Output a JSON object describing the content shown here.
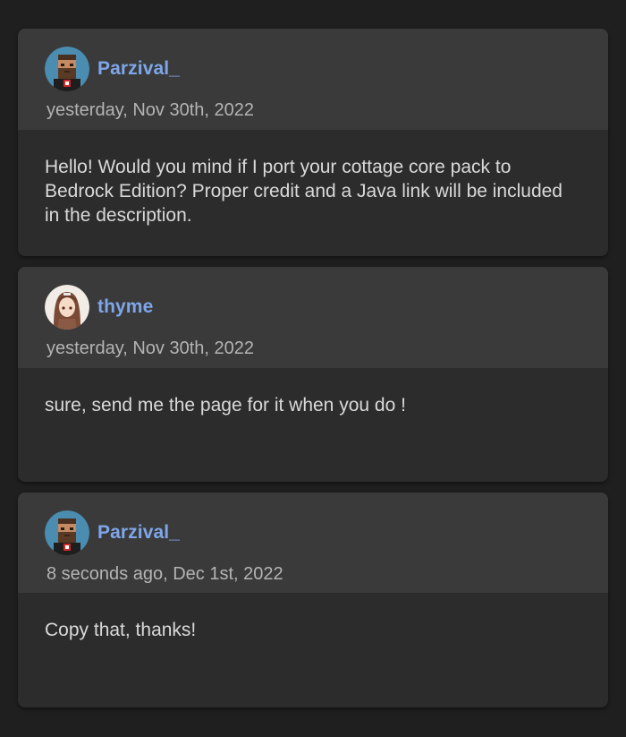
{
  "comments": [
    {
      "author": "Parzival_",
      "avatar": "pixel-bearded-man-avatar",
      "timestamp": "yesterday, Nov 30th, 2022",
      "text": "Hello! Would you mind if I port your cottage core pack to Bedrock Edition? Proper credit and a Java link will be included in the description."
    },
    {
      "author": "thyme",
      "avatar": "anime-girl-avatar",
      "timestamp": "yesterday, Nov 30th, 2022",
      "text": "sure, send me the page for it when you do !"
    },
    {
      "author": "Parzival_",
      "avatar": "pixel-bearded-man-avatar",
      "timestamp": "8 seconds ago, Dec 1st, 2022",
      "text": "Copy that, thanks!"
    }
  ],
  "colors": {
    "background": "#1f1f1f",
    "card": "#2c2c2c",
    "card_header": "#3a3a3a",
    "author_link": "#7ea6e8",
    "timestamp": "#b4b4b4",
    "body_text": "#d9d9d9"
  }
}
